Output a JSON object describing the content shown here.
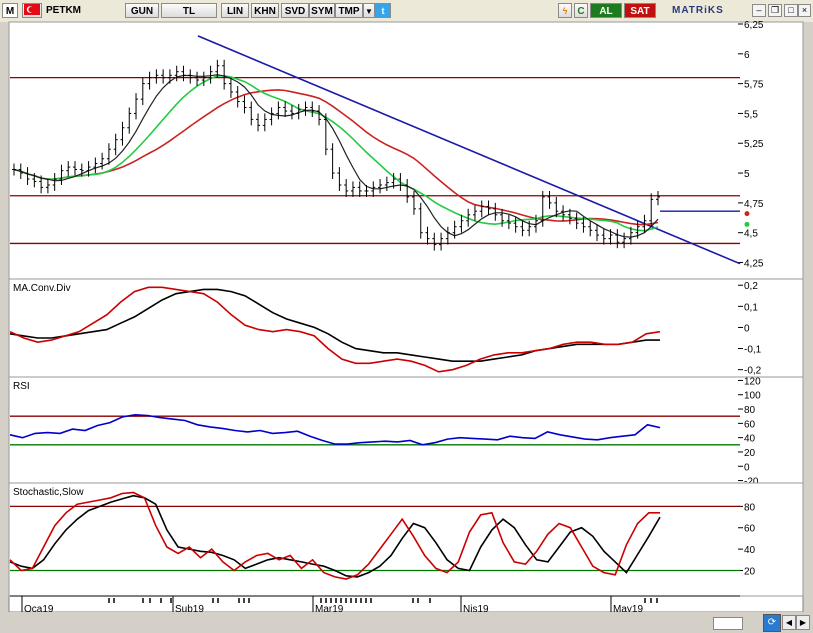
{
  "toolbar": {
    "m_label": "M",
    "symbol": "PETKM",
    "period": "GUN",
    "currency": "TL",
    "scale_lin": "LIN",
    "btn_khn": "KHN",
    "btn_svd": "SVD",
    "btn_sym": "SYM",
    "btn_tmp": "TMP",
    "buy_label": "AL",
    "sell_label": "SAT",
    "brand": "MATRiKS",
    "buy_color": "#1e7a1e",
    "sell_color": "#c01010"
  },
  "chart_data": [
    {
      "type": "ohlc",
      "pane": "price",
      "yticks": [
        "6,25",
        "6",
        "5,75",
        "5,5",
        "5,25",
        "5",
        "4,75",
        "4,5",
        "4,25"
      ],
      "ylim": [
        4.12,
        6.25
      ],
      "close": [
        5.03,
        5.0,
        4.95,
        4.93,
        4.88,
        4.9,
        4.95,
        5.02,
        5.05,
        5.03,
        5.02,
        5.05,
        5.08,
        5.12,
        5.2,
        5.28,
        5.38,
        5.5,
        5.62,
        5.75,
        5.8,
        5.82,
        5.8,
        5.82,
        5.85,
        5.82,
        5.8,
        5.78,
        5.8,
        5.85,
        5.9,
        5.75,
        5.68,
        5.6,
        5.55,
        5.45,
        5.4,
        5.45,
        5.5,
        5.55,
        5.52,
        5.5,
        5.53,
        5.55,
        5.52,
        5.45,
        5.2,
        5.0,
        4.9,
        4.85,
        4.88,
        4.85,
        4.85,
        4.88,
        4.9,
        4.92,
        4.95,
        4.9,
        4.8,
        4.7,
        4.5,
        4.45,
        4.4,
        4.45,
        4.5,
        4.55,
        4.6,
        4.65,
        4.68,
        4.72,
        4.7,
        4.65,
        4.6,
        4.58,
        4.55,
        4.52,
        4.55,
        4.6,
        4.8,
        4.75,
        4.68,
        4.65,
        4.62,
        4.58,
        4.55,
        4.52,
        4.48,
        4.45,
        4.48,
        4.42,
        4.45,
        4.5,
        4.55,
        4.6,
        4.78,
        4.8
      ],
      "reference_line_value": 4.68,
      "levels": [
        5.8,
        4.81,
        4.41
      ],
      "trendline": [
        [
          5,
          6.15
        ],
        [
          128,
          4.24
        ]
      ]
    },
    {
      "type": "line",
      "pane": "macd",
      "label": "MA.Conv.Div",
      "yticks": [
        "0,2",
        "0,1",
        "0",
        "-0,1",
        "-0,2"
      ],
      "ylim": [
        -0.23,
        0.22
      ],
      "series": [
        {
          "color": "#000000",
          "values": [
            -0.03,
            -0.04,
            -0.05,
            -0.05,
            -0.04,
            -0.03,
            -0.02,
            -0.01,
            0.02,
            0.05,
            0.09,
            0.13,
            0.16,
            0.17,
            0.18,
            0.18,
            0.17,
            0.15,
            0.11,
            0.07,
            0.04,
            0.02,
            0.0,
            -0.03,
            -0.07,
            -0.1,
            -0.11,
            -0.12,
            -0.12,
            -0.13,
            -0.14,
            -0.15,
            -0.16,
            -0.16,
            -0.16,
            -0.15,
            -0.14,
            -0.13,
            -0.11,
            -0.1,
            -0.09,
            -0.08,
            -0.08,
            -0.08,
            -0.08,
            -0.07,
            -0.06,
            -0.06
          ]
        },
        {
          "color": "#cc0000",
          "values": [
            -0.02,
            -0.05,
            -0.07,
            -0.06,
            -0.04,
            -0.02,
            0.02,
            0.06,
            0.12,
            0.17,
            0.19,
            0.19,
            0.18,
            0.17,
            0.16,
            0.12,
            0.06,
            0.01,
            -0.01,
            -0.02,
            -0.01,
            -0.02,
            -0.04,
            -0.1,
            -0.15,
            -0.17,
            -0.17,
            -0.16,
            -0.15,
            -0.16,
            -0.18,
            -0.21,
            -0.2,
            -0.18,
            -0.15,
            -0.13,
            -0.12,
            -0.12,
            -0.11,
            -0.1,
            -0.08,
            -0.07,
            -0.07,
            -0.08,
            -0.08,
            -0.07,
            -0.03,
            -0.02
          ]
        }
      ]
    },
    {
      "type": "line",
      "pane": "rsi",
      "label": "RSI",
      "yticks": [
        "120",
        "100",
        "80",
        "60",
        "40",
        "20",
        "0",
        "-20"
      ],
      "ylim": [
        -22,
        122
      ],
      "levels": [
        70,
        30
      ],
      "series": [
        {
          "color": "#0000cc",
          "values": [
            44,
            40,
            46,
            47,
            46,
            52,
            50,
            57,
            61,
            69,
            72,
            71,
            68,
            66,
            64,
            58,
            55,
            53,
            50,
            48,
            50,
            46,
            47,
            49,
            42,
            36,
            31,
            31,
            33,
            34,
            35,
            34,
            36,
            30,
            33,
            38,
            40,
            39,
            38,
            37,
            42,
            40,
            39,
            48,
            44,
            41,
            38,
            37,
            40,
            42,
            44,
            58,
            54
          ]
        }
      ]
    },
    {
      "type": "line",
      "pane": "stochastic",
      "label": "Stochastic,Slow",
      "yticks": [
        "80",
        "60",
        "40",
        "20"
      ],
      "ylim": [
        -2,
        100
      ],
      "levels": [
        80,
        20
      ],
      "series": [
        {
          "color": "#000000",
          "values": [
            28,
            24,
            22,
            30,
            45,
            58,
            68,
            76,
            80,
            84,
            87,
            90,
            88,
            82,
            58,
            42,
            40,
            38,
            37,
            34,
            30,
            22,
            26,
            30,
            32,
            30,
            28,
            26,
            24,
            20,
            15,
            14,
            18,
            24,
            34,
            50,
            64,
            60,
            46,
            30,
            22,
            20,
            42,
            58,
            68,
            60,
            44,
            30,
            28,
            42,
            56,
            60,
            52,
            38,
            28,
            18,
            35,
            52,
            70
          ]
        },
        {
          "color": "#cc0000",
          "values": [
            30,
            20,
            22,
            42,
            62,
            74,
            82,
            84,
            86,
            88,
            92,
            93,
            88,
            62,
            42,
            36,
            42,
            32,
            40,
            28,
            20,
            28,
            34,
            36,
            30,
            34,
            22,
            30,
            18,
            14,
            12,
            16,
            26,
            40,
            54,
            68,
            52,
            34,
            22,
            18,
            28,
            56,
            72,
            74,
            46,
            28,
            26,
            38,
            54,
            64,
            60,
            42,
            24,
            18,
            16,
            44,
            64,
            74,
            74
          ]
        }
      ]
    }
  ],
  "xaxis_labels": [
    "Oca19",
    "Şub19",
    "Mar19",
    "Nis19",
    "May19"
  ]
}
